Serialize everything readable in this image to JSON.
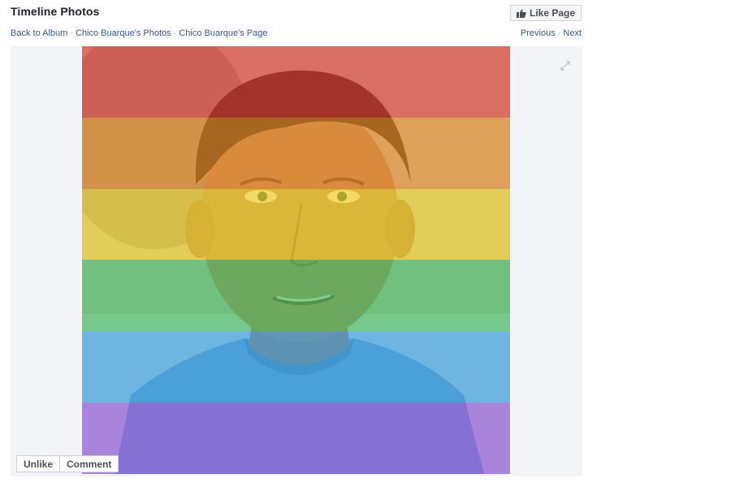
{
  "header": {
    "title": "Timeline Photos",
    "like_page_label": "Like Page"
  },
  "breadcrumb": {
    "items": [
      "Back to Album",
      "Chico Buarque's Photos",
      "Chico Buarque's Page"
    ],
    "separator": "·"
  },
  "pager": {
    "previous": "Previous",
    "separator": "·",
    "next": "Next"
  },
  "photo": {
    "overlay": "rainbow-flag",
    "stripe_colors": [
      "#e5392c",
      "#eb8a1c",
      "#f1d21a",
      "#3cbd55",
      "#2e9de0",
      "#8a4fd6"
    ]
  },
  "actions": {
    "unlike_label": "Unlike",
    "comment_label": "Comment"
  },
  "icons": {
    "like_page": "thumbs-up-icon",
    "expand": "expand-icon"
  }
}
